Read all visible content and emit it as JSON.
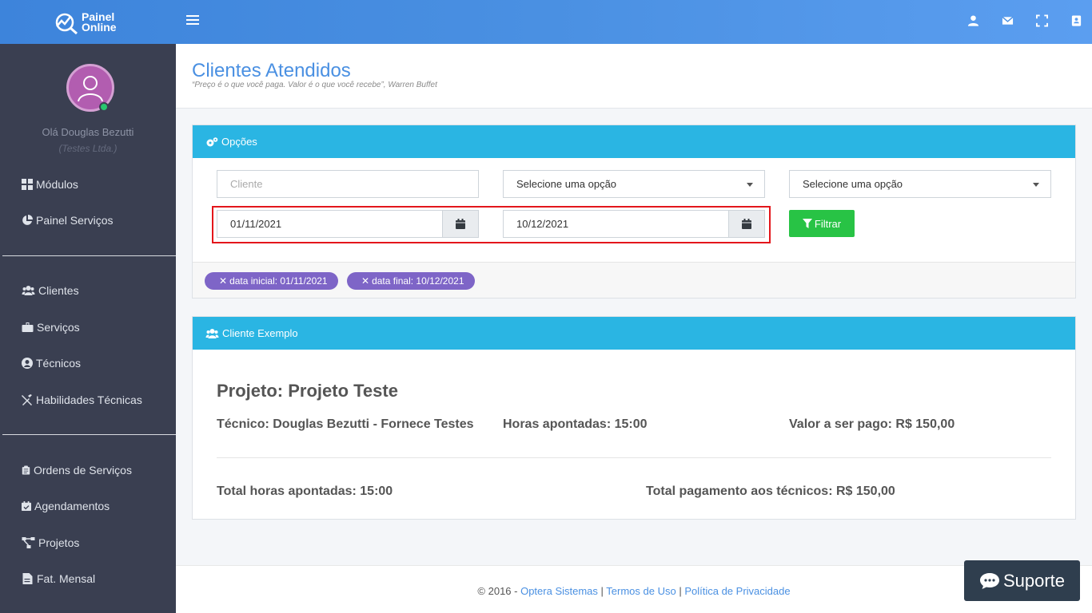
{
  "brand": {
    "line1": "Painel",
    "line2": "Online"
  },
  "topbar": {
    "icons": [
      "user-icon",
      "envelope-icon",
      "fullscreen-icon",
      "address-book-icon"
    ]
  },
  "user": {
    "greeting": "Olá Douglas Bezutti",
    "company": "(Testes Ltda.)"
  },
  "sidebar": {
    "items": [
      {
        "label": "Módulos",
        "icon": "grid-icon"
      },
      {
        "label": "Painel Serviços",
        "icon": "pie-chart-icon"
      },
      {
        "label": "Clientes",
        "icon": "users-icon"
      },
      {
        "label": "Serviços",
        "icon": "briefcase-icon"
      },
      {
        "label": "Técnicos",
        "icon": "user-circle-icon"
      },
      {
        "label": "Habilidades Técnicas",
        "icon": "tools-icon"
      },
      {
        "label": "Ordens de Serviços",
        "icon": "clipboard-icon"
      },
      {
        "label": "Agendamentos",
        "icon": "calendar-check-icon"
      },
      {
        "label": "Projetos",
        "icon": "project-diagram-icon"
      },
      {
        "label": "Fat. Mensal",
        "icon": "file-invoice-icon"
      }
    ]
  },
  "page": {
    "title": "Clientes Atendidos",
    "quote": "“Preço é o que você paga. Valor é o que você recebe”, Warren Buffet"
  },
  "options": {
    "header": "Opções",
    "client_placeholder": "Cliente",
    "select1": "Selecione uma opção",
    "select2": "Selecione uma opção",
    "date_start": "01/11/2021",
    "date_end": "10/12/2021",
    "filter_label": "Filtrar",
    "tags": [
      "data inicial: 01/11/2021",
      "data final: 10/12/2021"
    ]
  },
  "result": {
    "header": "Cliente Exemplo",
    "project": "Projeto: Projeto Teste",
    "tecnico": "Técnico: Douglas Bezutti - Fornece Testes",
    "horas": "Horas apontadas: 15:00",
    "valor": "Valor a ser pago: R$ 150,00",
    "total_horas": "Total horas apontadas: 15:00",
    "total_pagamento": "Total pagamento aos técnicos: R$ 150,00"
  },
  "footer": {
    "copyright": "© 2016 - ",
    "link1": "Optera Sistemas",
    "sep1": " | ",
    "link2": "Termos de Uso",
    "sep2": " | ",
    "link3": "Política de Privacidade"
  },
  "support": {
    "label": "Suporte"
  },
  "colors": {
    "topbar": "#4a90e2",
    "sidebar": "#3a3f51",
    "card_header": "#2ab5e3",
    "tag": "#7e65c7",
    "filter": "#28c345",
    "highlight": "#e3161b"
  }
}
